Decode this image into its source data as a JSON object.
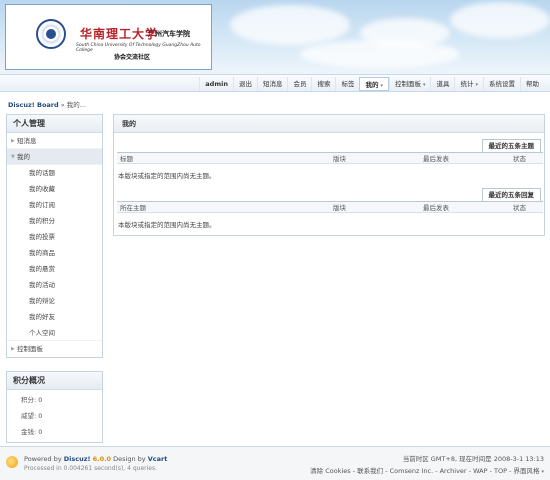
{
  "banner": {
    "school_cn": "华南理工大学",
    "school_sub": "广州汽车学院",
    "school_en": "South China University Of Technology GuangZhou Auto College",
    "club_name": "协会交流社区"
  },
  "nav": {
    "items": [
      "admin",
      "退出",
      "短消息",
      "会员",
      "搜索",
      "标签",
      "我的",
      "控制面板",
      "道具",
      "统计",
      "系统设置",
      "帮助"
    ]
  },
  "breadcrumb": {
    "home": "Discuz! Board",
    "sep": "»",
    "current": "我的..."
  },
  "sidebar": {
    "title": "个人管理",
    "items": [
      "短消息",
      "我的"
    ],
    "sub_items": [
      "我的话题",
      "我的收藏",
      "我的订阅",
      "我的积分",
      "我的投票",
      "我的商品",
      "我的悬赏",
      "我的活动",
      "我的辩论",
      "我的好友",
      "个人空间"
    ],
    "control_panel": "控制面板"
  },
  "score": {
    "title": "积分概况",
    "rows": [
      "积分: 0",
      "威望: 0",
      "金钱: 0"
    ]
  },
  "main": {
    "title": "我的",
    "topics": {
      "tab": "最近的五条主题",
      "headers": [
        "标题",
        "版块",
        "最后发表",
        "状态"
      ],
      "empty": "本版块或指定的范围内尚无主题。"
    },
    "replies": {
      "tab": "最近的五条回复",
      "headers": [
        "所在主题",
        "版块",
        "最后发表",
        "状态"
      ],
      "empty": "本版块或指定的范围内尚无主题。"
    }
  },
  "footer": {
    "powered_prefix": "Powered by",
    "product": "Discuz!",
    "version": "6.0.0",
    "design_by": "Design by",
    "designer": "Vcart",
    "processed": "Processed in 0.004261 second(s), 4 queries.",
    "time": "当前时区  GMT+8, 现在时间是  2008-3-1 13:13",
    "links": "清除 Cookies - 联系我们 - Comsenz Inc. - Archiver - WAP - TOP - 界面风格"
  }
}
